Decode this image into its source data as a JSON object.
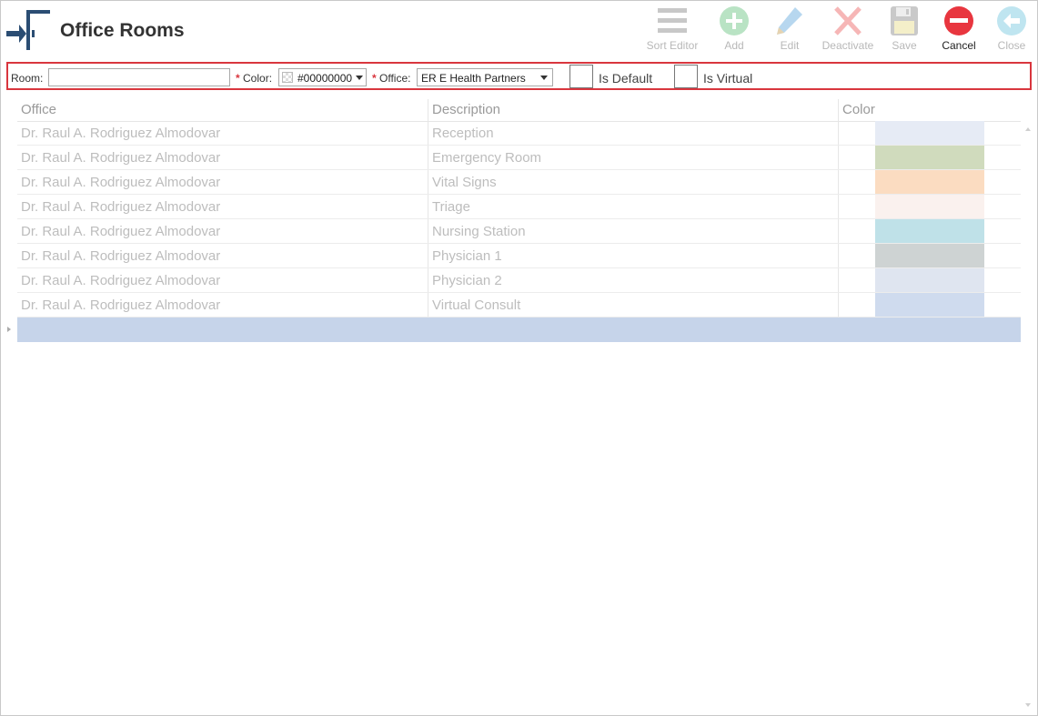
{
  "header": {
    "title": "Office Rooms"
  },
  "toolbar": [
    {
      "label": "Sort Editor",
      "icon": "sort-editor-icon",
      "enabled": false
    },
    {
      "label": "Add",
      "icon": "add-icon",
      "enabled": false
    },
    {
      "label": "Edit",
      "icon": "edit-pencil-icon",
      "enabled": false
    },
    {
      "label": "Deactivate",
      "icon": "deactivate-x-icon",
      "enabled": false
    },
    {
      "label": "Save",
      "icon": "save-disk-icon",
      "enabled": false
    },
    {
      "label": "Cancel",
      "icon": "cancel-icon",
      "enabled": true
    },
    {
      "label": "Close",
      "icon": "close-back-arrow-icon",
      "enabled": false
    }
  ],
  "filter": {
    "room_label": "Room:",
    "room_value": "",
    "required_mark": "*",
    "color_label": "Color:",
    "color_value": "#00000000",
    "office_label": "Office:",
    "office_value": "ER E Health Partners",
    "is_default_label": "Is Default",
    "is_default_checked": false,
    "is_virtual_label": "Is Virtual",
    "is_virtual_checked": false
  },
  "grid": {
    "columns": [
      "Office",
      "Description",
      "Color"
    ],
    "rows": [
      {
        "office": "Dr. Raul A. Rodriguez Almodovar",
        "description": "Reception",
        "color": "#e6ebf5"
      },
      {
        "office": "Dr. Raul A. Rodriguez Almodovar",
        "description": "Emergency Room",
        "color": "#d0dbbd"
      },
      {
        "office": "Dr. Raul A. Rodriguez Almodovar",
        "description": "Vital Signs",
        "color": "#fbdcc1"
      },
      {
        "office": "Dr. Raul A. Rodriguez Almodovar",
        "description": "Triage",
        "color": "#faf1ee"
      },
      {
        "office": "Dr. Raul A. Rodriguez Almodovar",
        "description": "Nursing Station",
        "color": "#bfe1e8"
      },
      {
        "office": "Dr. Raul A. Rodriguez Almodovar",
        "description": "Physician 1",
        "color": "#ced3d3"
      },
      {
        "office": "Dr. Raul A. Rodriguez Almodovar",
        "description": "Physician 2",
        "color": "#dfe5f0"
      },
      {
        "office": "Dr. Raul A. Rodriguez Almodovar",
        "description": "Virtual Consult",
        "color": "#cfdbee"
      }
    ],
    "new_row_color": "#c6d4ea"
  }
}
